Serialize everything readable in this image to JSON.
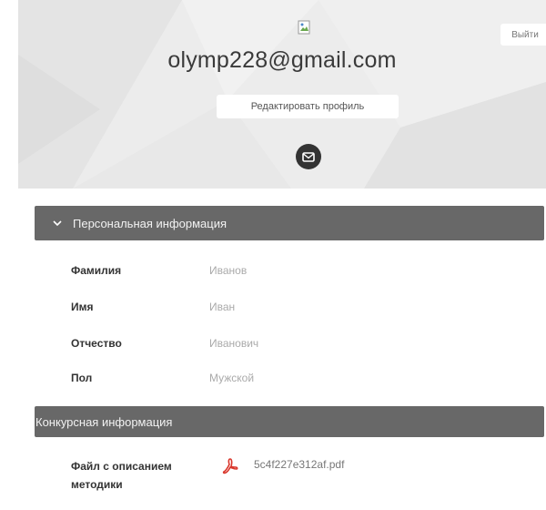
{
  "header": {
    "email": "olymp228@gmail.com",
    "logout_label": "Выйти",
    "edit_profile_label": "Редактировать профиль",
    "avatar_icon": "broken-image-icon",
    "mail_icon": "envelope-icon"
  },
  "personal_section": {
    "title": "Персональная информация",
    "icon": "chevron-down-icon",
    "fields": [
      {
        "label": "Фамилия",
        "value": "Иванов"
      },
      {
        "label": "Имя",
        "value": "Иван"
      },
      {
        "label": "Отчество",
        "value": "Иванович"
      },
      {
        "label": "Пол",
        "value": "Мужской"
      }
    ]
  },
  "contest_section": {
    "title": "Конкурсная информация",
    "file_label": "Файл с описанием методики",
    "file_name": "5c4f227e312af.pdf",
    "file_icon": "pdf-icon"
  },
  "colors": {
    "section_bar": "#686868",
    "header_bg": "#ececec",
    "pdf_red": "#d9362b"
  }
}
